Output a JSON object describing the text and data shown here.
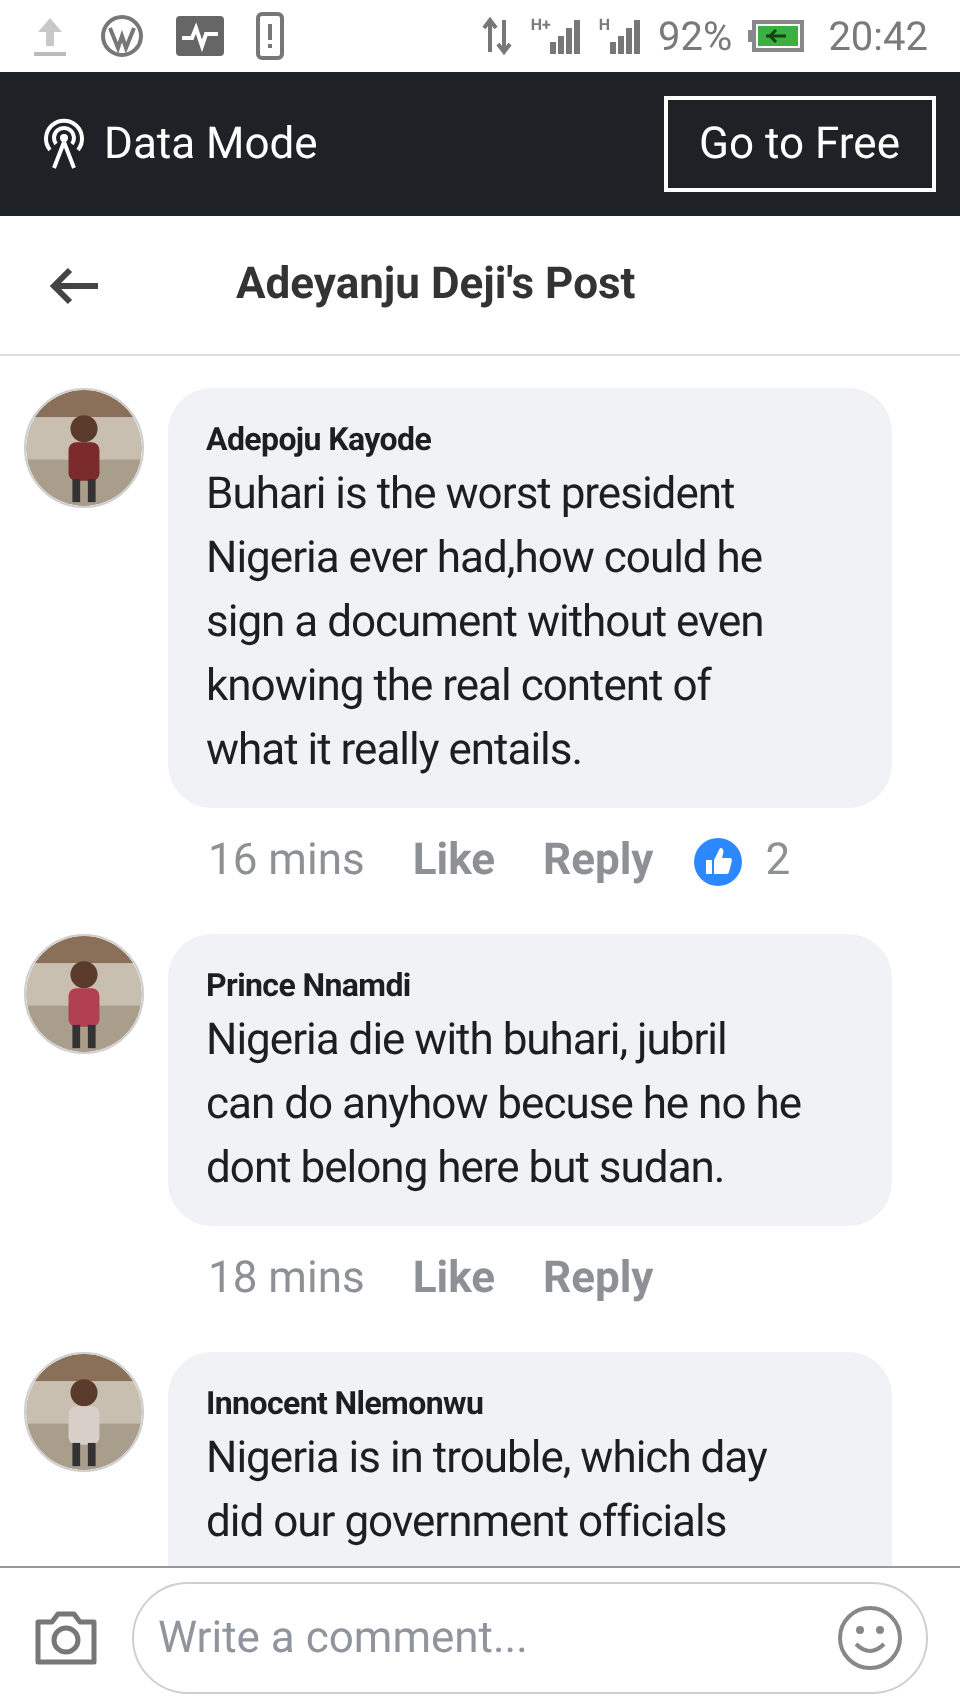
{
  "status_bar": {
    "network_types": [
      "H+",
      "H"
    ],
    "battery": "92%",
    "time": "20:42"
  },
  "data_mode_bar": {
    "label": "Data Mode",
    "button": "Go to Free"
  },
  "header": {
    "title": "Adeyanju Deji's Post"
  },
  "comments": [
    {
      "author": "Adepoju Kayode",
      "lines": [
        "Buhari is the worst president",
        "Nigeria ever had,how could he",
        "sign a document without even",
        "knowing the real content of",
        "what it really entails."
      ],
      "time": "16 mins",
      "like": "Like",
      "reply": "Reply",
      "reactions": "2"
    },
    {
      "author": "Prince Nnamdi",
      "lines": [
        "Nigeria die with buhari, jubril",
        "can do anyhow becuse he no he",
        "dont belong here but sudan."
      ],
      "time": "18 mins",
      "like": "Like",
      "reply": "Reply"
    },
    {
      "author": "Innocent Nlemonwu",
      "lines": [
        "Nigeria is in trouble, which day",
        "did our government officials"
      ]
    }
  ],
  "composer": {
    "placeholder": "Write a comment..."
  }
}
